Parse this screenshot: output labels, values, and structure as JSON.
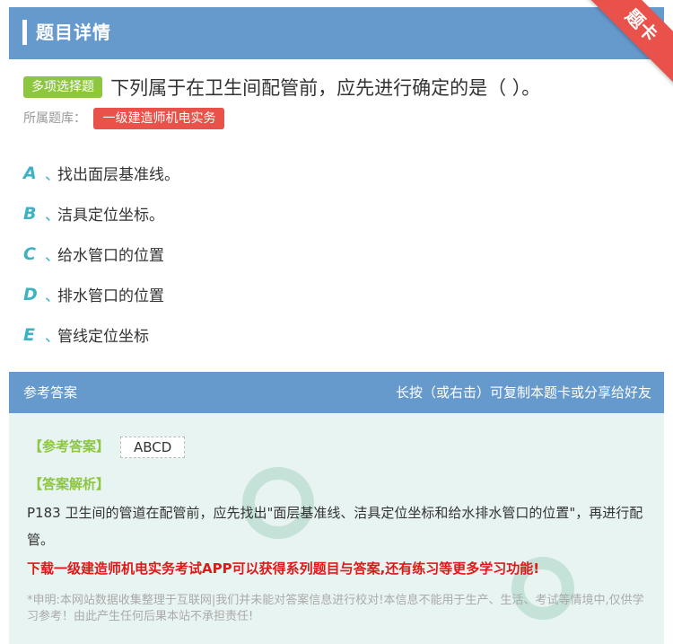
{
  "header": {
    "title": "题目详情",
    "ribbon": "题卡"
  },
  "question": {
    "type_badge": "多项选择题",
    "text": "下列属于在卫生间配管前，应先进行确定的是（    ）。",
    "bank_label": "所属题库：",
    "bank_name": "一级建造师机电实务"
  },
  "options": [
    {
      "letter": "A",
      "sep": "、",
      "text": "找出面层基准线。"
    },
    {
      "letter": "B",
      "sep": "、",
      "text": "洁具定位坐标。"
    },
    {
      "letter": "C",
      "sep": "、",
      "text": "给水管口的位置"
    },
    {
      "letter": "D",
      "sep": "、",
      "text": "排水管口的位置"
    },
    {
      "letter": "E",
      "sep": "、",
      "text": "管线定位坐标"
    }
  ],
  "answer_section": {
    "title": "参考答案",
    "hint": "长按（或右击）可复制本题卡或分享给好友",
    "answer_label": "【参考答案】",
    "answer_value": "ABCD",
    "analysis_label": "【答案解析】",
    "analysis_text": "P183 卫生间的管道在配管前，应先找出\"面层基准线、洁具定位坐标和给水排水管口的位置\"，再进行配管。",
    "promo": "下载一级建造师机电实务考试APP可以获得系列题目与答案,还有练习等更多学习功能!",
    "disclaimer": "*申明:本网站数据收集整理于互联网|我们并未能对答案信息进行校对!本信息不能用于生产、生活、考试等情境中,仅供学习参考！由此产生任何后果本站不承担责任!"
  },
  "colors": {
    "header_blue": "#6699cc",
    "accent_red": "#e8524a",
    "accent_green": "#8dc63f",
    "option_teal": "#3bb3c3"
  }
}
